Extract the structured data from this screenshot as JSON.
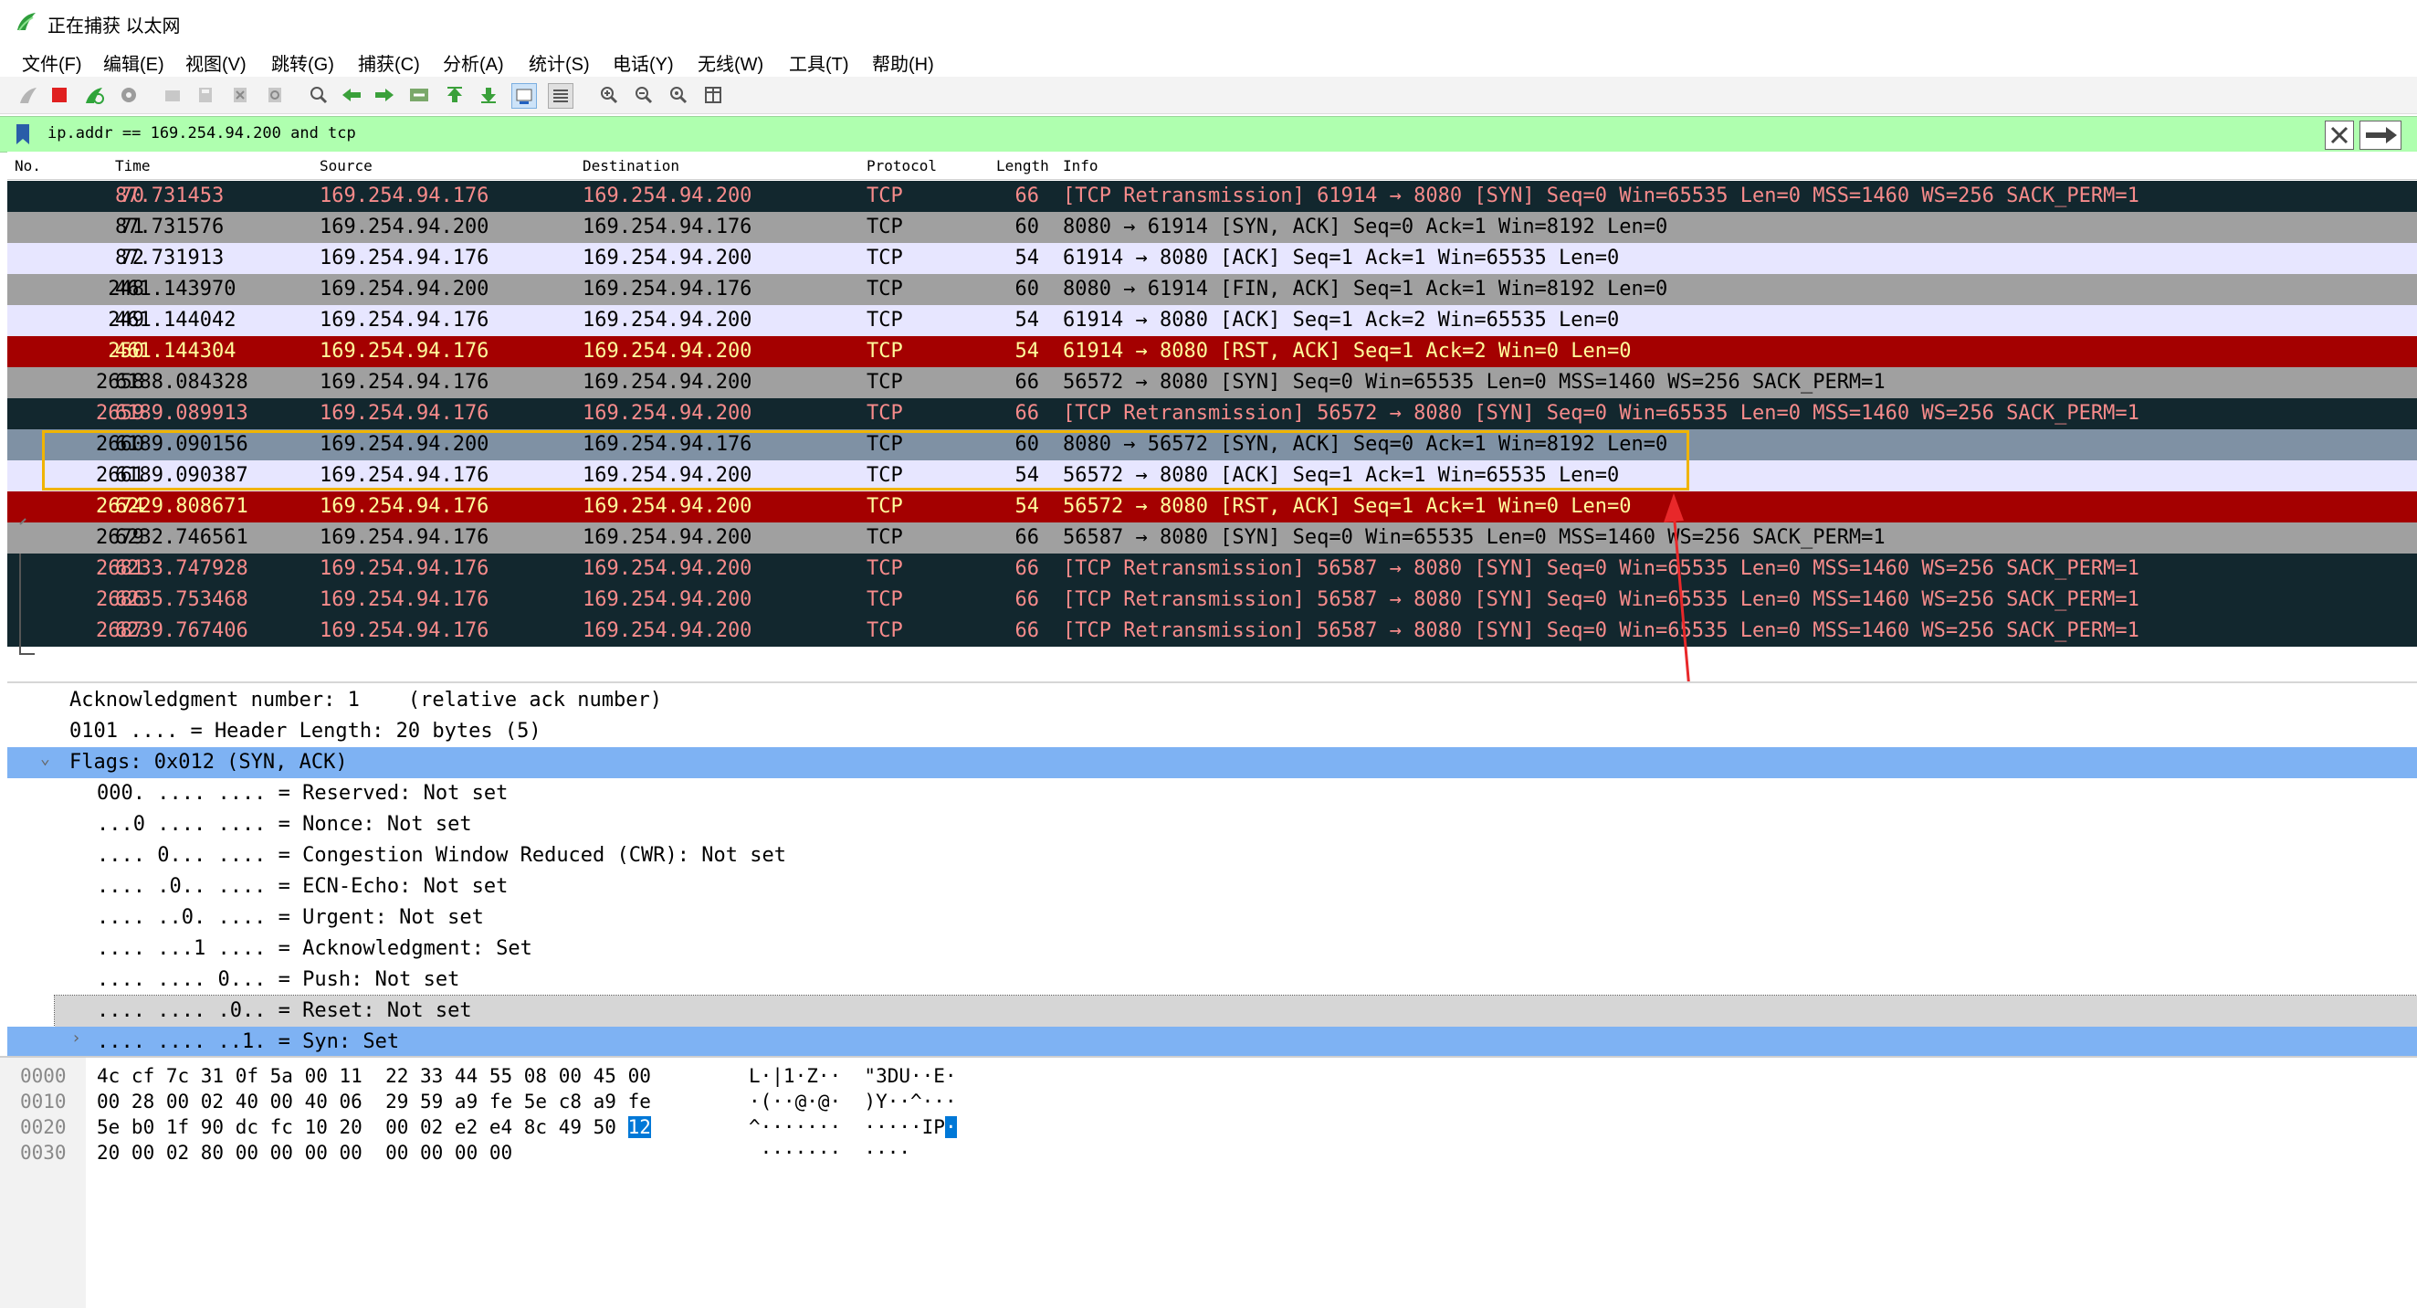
{
  "window": {
    "title": "正在捕获 以太网"
  },
  "menu": [
    "文件(F)",
    "编辑(E)",
    "视图(V)",
    "跳转(G)",
    "捕获(C)",
    "分析(A)",
    "统计(S)",
    "电话(Y)",
    "无线(W)",
    "工具(T)",
    "帮助(H)"
  ],
  "toolbar": [
    "shark-fin-start-icon",
    "stop-icon",
    "restart-icon",
    "options-icon",
    "open-file-icon",
    "save-file-icon",
    "close-file-icon",
    "reload-icon",
    "find-icon",
    "go-back-icon",
    "go-forward-icon",
    "go-to-packet-icon",
    "go-first-icon",
    "go-last-icon",
    "autoscroll-icon",
    "colorize-icon",
    "zoom-in-icon",
    "zoom-out-icon",
    "zoom-normal-icon",
    "resize-columns-icon"
  ],
  "filter": {
    "value": "ip.addr == 169.254.94.200 and tcp"
  },
  "columns": [
    "No.",
    "Time",
    "Source",
    "Destination",
    "Protocol",
    "Length",
    "Info"
  ],
  "packets": [
    {
      "no": "70",
      "time": "87.731453",
      "src": "169.254.94.176",
      "dst": "169.254.94.200",
      "proto": "TCP",
      "len": "66",
      "info": "[TCP Retransmission] 61914 → 8080 [SYN] Seq=0 Win=65535 Len=0 MSS=1460 WS=256 SACK_PERM=1",
      "style": "dark"
    },
    {
      "no": "71",
      "time": "87.731576",
      "src": "169.254.94.200",
      "dst": "169.254.94.176",
      "proto": "TCP",
      "len": "60",
      "info": "8080 → 61914 [SYN, ACK] Seq=0 Ack=1 Win=8192 Len=0",
      "style": "gray"
    },
    {
      "no": "72",
      "time": "87.731913",
      "src": "169.254.94.176",
      "dst": "169.254.94.200",
      "proto": "TCP",
      "len": "54",
      "info": "61914 → 8080 [ACK] Seq=1 Ack=1 Win=65535 Len=0",
      "style": "light"
    },
    {
      "no": "248",
      "time": "461.143970",
      "src": "169.254.94.200",
      "dst": "169.254.94.176",
      "proto": "TCP",
      "len": "60",
      "info": "8080 → 61914 [FIN, ACK] Seq=1 Ack=1 Win=8192 Len=0",
      "style": "gray"
    },
    {
      "no": "249",
      "time": "461.144042",
      "src": "169.254.94.176",
      "dst": "169.254.94.200",
      "proto": "TCP",
      "len": "54",
      "info": "61914 → 8080 [ACK] Seq=1 Ack=2 Win=65535 Len=0",
      "style": "light"
    },
    {
      "no": "250",
      "time": "461.144304",
      "src": "169.254.94.176",
      "dst": "169.254.94.200",
      "proto": "TCP",
      "len": "54",
      "info": "61914 → 8080 [RST, ACK] Seq=1 Ack=2 Win=0 Len=0",
      "style": "red"
    },
    {
      "no": "2658",
      "time": "6188.084328",
      "src": "169.254.94.176",
      "dst": "169.254.94.200",
      "proto": "TCP",
      "len": "66",
      "info": "56572 → 8080 [SYN] Seq=0 Win=65535 Len=0 MSS=1460 WS=256 SACK_PERM=1",
      "style": "gray"
    },
    {
      "no": "2659",
      "time": "6189.089913",
      "src": "169.254.94.176",
      "dst": "169.254.94.200",
      "proto": "TCP",
      "len": "66",
      "info": "[TCP Retransmission] 56572 → 8080 [SYN] Seq=0 Win=65535 Len=0 MSS=1460 WS=256 SACK_PERM=1",
      "style": "dark"
    },
    {
      "no": "2660",
      "time": "6189.090156",
      "src": "169.254.94.200",
      "dst": "169.254.94.176",
      "proto": "TCP",
      "len": "60",
      "info": "8080 → 56572 [SYN, ACK] Seq=0 Ack=1 Win=8192 Len=0",
      "style": "selected"
    },
    {
      "no": "2661",
      "time": "6189.090387",
      "src": "169.254.94.176",
      "dst": "169.254.94.200",
      "proto": "TCP",
      "len": "54",
      "info": "56572 → 8080 [ACK] Seq=1 Ack=1 Win=65535 Len=0",
      "style": "light"
    },
    {
      "no": "2674",
      "time": "6229.808671",
      "src": "169.254.94.176",
      "dst": "169.254.94.200",
      "proto": "TCP",
      "len": "54",
      "info": "56572 → 8080 [RST, ACK] Seq=1 Ack=1 Win=0 Len=0",
      "style": "red"
    },
    {
      "no": "2679",
      "time": "6232.746561",
      "src": "169.254.94.176",
      "dst": "169.254.94.200",
      "proto": "TCP",
      "len": "66",
      "info": "56587 → 8080 [SYN] Seq=0 Win=65535 Len=0 MSS=1460 WS=256 SACK_PERM=1",
      "style": "gray"
    },
    {
      "no": "2681",
      "time": "6233.747928",
      "src": "169.254.94.176",
      "dst": "169.254.94.200",
      "proto": "TCP",
      "len": "66",
      "info": "[TCP Retransmission] 56587 → 8080 [SYN] Seq=0 Win=65535 Len=0 MSS=1460 WS=256 SACK_PERM=1",
      "style": "dark"
    },
    {
      "no": "2686",
      "time": "6235.753468",
      "src": "169.254.94.176",
      "dst": "169.254.94.200",
      "proto": "TCP",
      "len": "66",
      "info": "[TCP Retransmission] 56587 → 8080 [SYN] Seq=0 Win=65535 Len=0 MSS=1460 WS=256 SACK_PERM=1",
      "style": "dark"
    },
    {
      "no": "2687",
      "time": "6239.767406",
      "src": "169.254.94.176",
      "dst": "169.254.94.200",
      "proto": "TCP",
      "len": "66",
      "info": "[TCP Retransmission] 56587 → 8080 [SYN] Seq=0 Win=65535 Len=0 MSS=1460 WS=256 SACK_PERM=1",
      "style": "dark"
    }
  ],
  "details": [
    {
      "text": "Acknowledgment number: 1    (relative ack number)",
      "indent": 1,
      "style": "normal"
    },
    {
      "text": "0101 .... = Header Length: 20 bytes (5)",
      "indent": 1,
      "style": "normal"
    },
    {
      "text": "Flags: 0x012 (SYN, ACK)",
      "indent": 1,
      "style": "blue",
      "expander": "⌄"
    },
    {
      "text": "000. .... .... = Reserved: Not set",
      "indent": 2,
      "style": "normal"
    },
    {
      "text": "...0 .... .... = Nonce: Not set",
      "indent": 2,
      "style": "normal"
    },
    {
      "text": ".... 0... .... = Congestion Window Reduced (CWR): Not set",
      "indent": 2,
      "style": "normal"
    },
    {
      "text": ".... .0.. .... = ECN-Echo: Not set",
      "indent": 2,
      "style": "normal"
    },
    {
      "text": ".... ..0. .... = Urgent: Not set",
      "indent": 2,
      "style": "normal"
    },
    {
      "text": ".... ...1 .... = Acknowledgment: Set",
      "indent": 2,
      "style": "normal"
    },
    {
      "text": ".... .... 0... = Push: Not set",
      "indent": 2,
      "style": "normal"
    },
    {
      "text": ".... .... .0.. = Reset: Not set",
      "indent": 2,
      "style": "grayhl"
    },
    {
      "text": ".... .... ..1. = Syn: Set",
      "indent": 2,
      "style": "blue",
      "expander": "›"
    }
  ],
  "hex": [
    {
      "offset": "0000",
      "bytes": "4c cf 7c 31 0f 5a 00 11  22 33 44 55 08 00 45 00",
      "ascii": "L·|1·Z··  \"3DU··E·"
    },
    {
      "offset": "0010",
      "bytes": "00 28 00 02 40 00 40 06  29 59 a9 fe 5e c8 a9 fe",
      "ascii": "·(··@·@·  )Y··^···"
    },
    {
      "offset": "0020",
      "bytes": "5e b0 1f 90 dc fc 10 20  00 02 e2 e4 8c 49 50 ",
      "bytes_sel": "12",
      "ascii": "^·······  ·····IP",
      "ascii_sel": "·"
    },
    {
      "offset": "0030",
      "bytes": "20 00 02 80 00 00 00 00  00 00 00 00",
      "ascii": " ·······  ····"
    }
  ],
  "colors": {
    "dark_bg": "#12272e",
    "dark_fg": "#f78b8b",
    "gray_bg": "#a0a0a0",
    "gray_fg": "#000000",
    "light_bg": "#e7e6ff",
    "light_fg": "#000000",
    "red_bg": "#a40000",
    "red_fg": "#fffc9c",
    "selected_bg": "#7f91a4",
    "selected_fg": "#000000",
    "detail_blue": "#7eb2f3",
    "detail_gray": "#d6d6d6",
    "annotation_box": "#f0b400",
    "annotation_arrow": "#e8282a"
  }
}
